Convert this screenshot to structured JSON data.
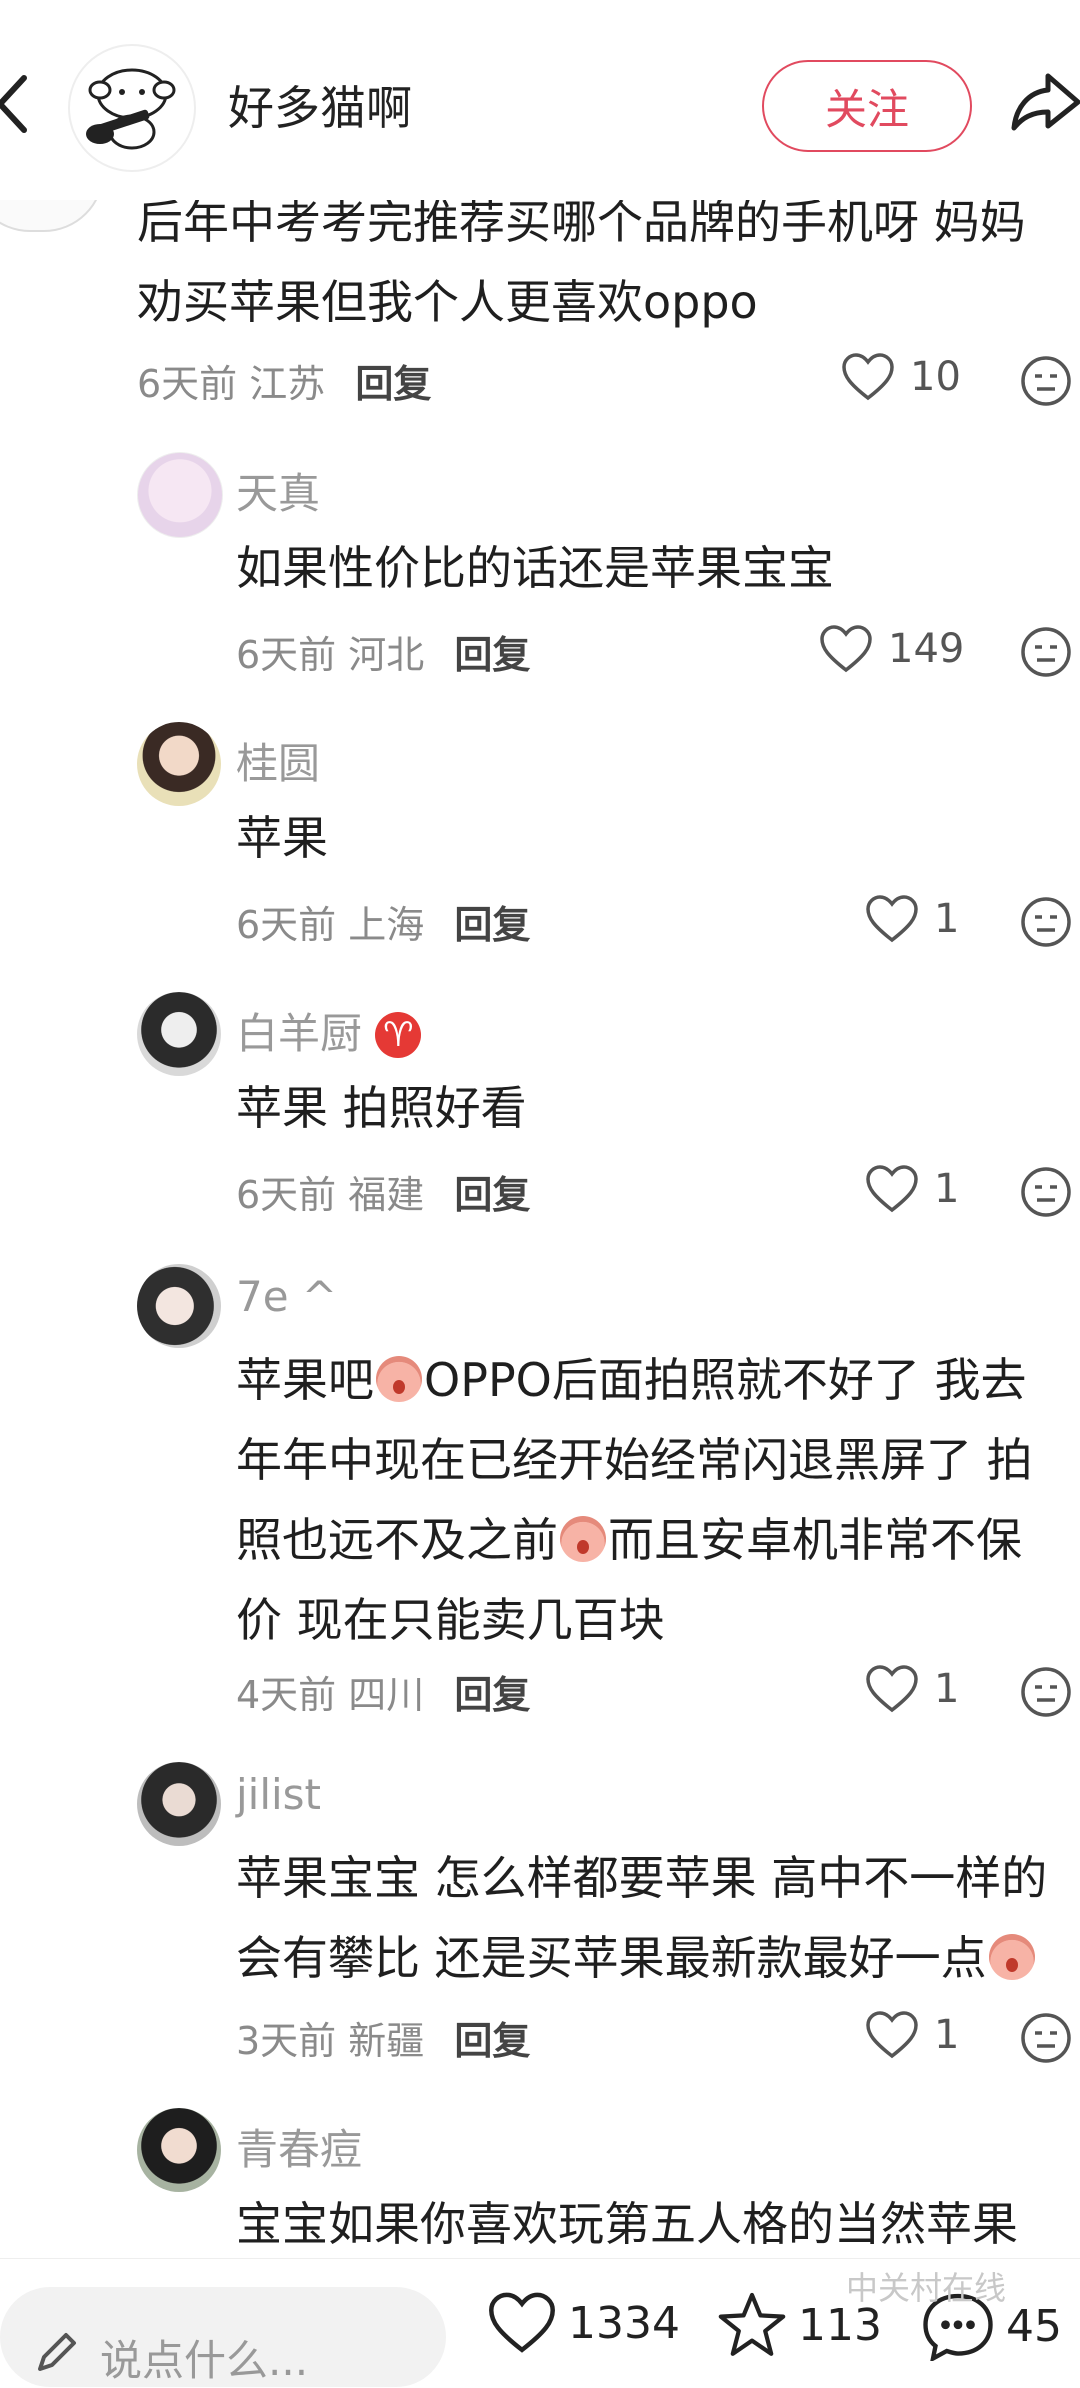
{
  "header": {
    "author_name": "好多猫啊",
    "follow_label": "关注"
  },
  "main_comment": {
    "text": "后年中考考完推荐买哪个品牌的手机呀 妈妈劝买苹果但我个人更喜欢oppo",
    "time": "6天前",
    "location": "江苏",
    "reply_label": "回复",
    "likes": "10"
  },
  "replies": [
    {
      "name": "天真",
      "text": "如果性价比的话还是苹果宝宝",
      "time": "6天前",
      "location": "河北",
      "likes": "149"
    },
    {
      "name": "桂圆",
      "text": "苹果",
      "time": "6天前",
      "location": "上海",
      "likes": "1"
    },
    {
      "name": "白羊厨",
      "badge": "♈",
      "text": "苹果 拍照好看",
      "time": "6天前",
      "location": "福建",
      "likes": "1"
    },
    {
      "name": "7e ^",
      "text_a": "苹果吧",
      "text_b": "OPPO后面拍照就不好了 我去年年中现在已经开始经常闪退黑屏了 拍照也远不及之前",
      "text_c": "而且安卓机非常不保价 现在只能卖几百块",
      "time": "4天前",
      "location": "四川",
      "likes": "1"
    },
    {
      "name": "jilist",
      "text": "苹果宝宝 怎么样都要苹果 高中不一样的会有攀比 还是买苹果最新款最好一点",
      "time": "3天前",
      "location": "新疆",
      "likes": "1"
    },
    {
      "name": "青春痘",
      "text": "宝宝如果你喜欢玩第五人格的当然苹果"
    }
  ],
  "reply_label": "回复",
  "bottom_bar": {
    "input_placeholder": "说点什么...",
    "likes_count": "1334",
    "stars_count": "113",
    "comments_count": "45",
    "watermark": "中关村在线"
  },
  "colors": {
    "accent": "#e14a5f",
    "meta_gray": "#8a8a8a"
  }
}
